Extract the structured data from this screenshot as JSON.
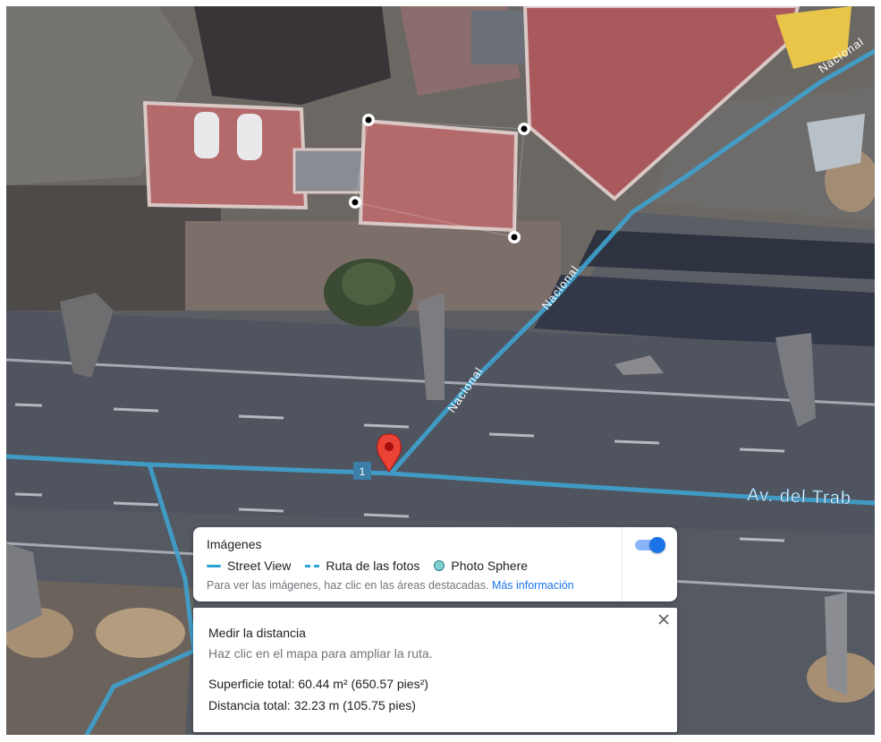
{
  "map": {
    "labels": {
      "nacional_top": "Nacional",
      "nacional_mid": "Nacional",
      "nacional_low": "Nacional",
      "avenue": "Av. del Trab",
      "route_shield": "1"
    },
    "colors": {
      "street_view_line": "#2ba3d5",
      "pin": "#ea4335",
      "roof": "#b46a6b"
    },
    "icons": [
      "map-pin-icon",
      "measure-point-icon"
    ]
  },
  "imagery_panel": {
    "title": "Imágenes",
    "legend": {
      "street_view": "Street View",
      "photo_route": "Ruta de las fotos",
      "photo_sphere": "Photo Sphere"
    },
    "hint": "Para ver las imágenes, haz clic en las áreas destacadas.",
    "more_info_link": "Más información",
    "toggle_on": true
  },
  "measure_panel": {
    "title": "Medir la distancia",
    "hint": "Haz clic en el mapa para ampliar la ruta.",
    "total_area": "Superficie total: 60.44 m² (650.57 pies²)",
    "total_distance": "Distancia total: 32.23 m (105.75 pies)",
    "close_icon": "close-icon"
  }
}
